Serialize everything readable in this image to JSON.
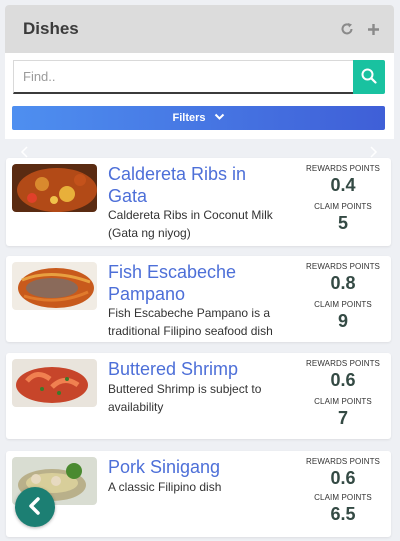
{
  "header": {
    "title": "Dishes",
    "refresh_icon": "refresh-icon",
    "add_icon": "plus-icon"
  },
  "search": {
    "placeholder": "Find..",
    "value": "",
    "button_icon": "search-icon"
  },
  "filters": {
    "label": "Filters",
    "icon": "chevron-down-icon"
  },
  "labels": {
    "rewards": "REWARDS POINTS",
    "claim": "CLAIM POINTS"
  },
  "dishes": [
    {
      "name": "Caldereta Ribs in Gata",
      "description": "Caldereta Ribs in Coconut Milk (Gata ng niyog)",
      "rewards_points": "0.4",
      "claim_points": "5"
    },
    {
      "name": "Fish Escabeche Pampano",
      "description": "Fish Escabeche Pampano is a traditional Filipino seafood dish",
      "rewards_points": "0.8",
      "claim_points": "9"
    },
    {
      "name": "Buttered Shrimp",
      "description": "Buttered Shrimp is subject to availability",
      "rewards_points": "0.6",
      "claim_points": "7"
    },
    {
      "name": "Pork Sinigang",
      "description": "A classic Filipino dish",
      "rewards_points": "0.6",
      "claim_points": "6.5"
    }
  ],
  "colors": {
    "accent": "#4d6fd8",
    "search_button": "#19c2a0",
    "back_button": "#1c7f73"
  }
}
